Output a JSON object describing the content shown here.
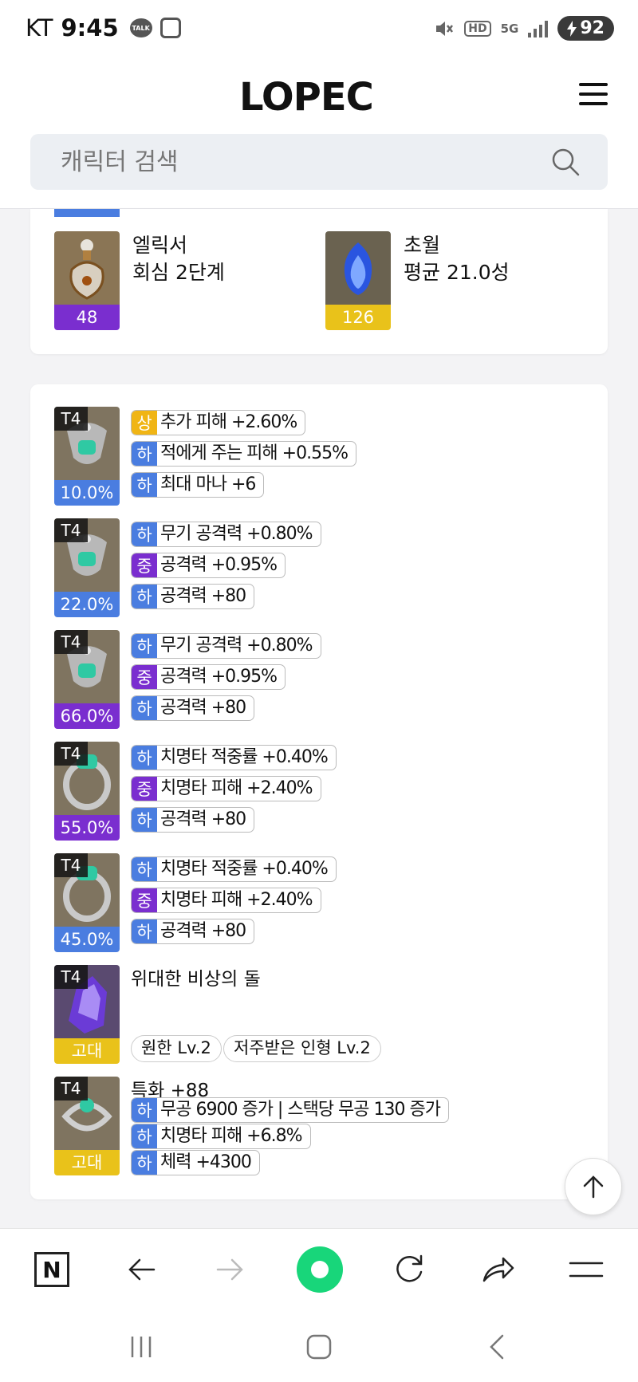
{
  "status": {
    "carrier": "KT",
    "time": "9:45",
    "talk": "TALK",
    "hd": "HD",
    "network": "5G",
    "battery": "92"
  },
  "header": {
    "logo": "LOPEC",
    "search_placeholder": "캐릭터 검색"
  },
  "card1": {
    "items": [
      {
        "name": "엘릭서",
        "detail": "회심 2단계",
        "foot": "48",
        "foot_color": "#7a2ecf"
      },
      {
        "name": "초월",
        "detail": "평균 21.0성",
        "foot": "126",
        "foot_color": "#e9c21a"
      }
    ]
  },
  "grade_colors": {
    "상": "#f0b515",
    "중": "#7a2ecf",
    "하": "#4a7de0"
  },
  "accessories": [
    {
      "tier": "T4",
      "quality": "10.0%",
      "foot_color": "#4a7de0",
      "options": [
        {
          "grade": "상",
          "text": "추가 피해 +2.60%"
        },
        {
          "grade": "하",
          "text": "적에게 주는 피해 +0.55%"
        },
        {
          "grade": "하",
          "text": "최대 마나 +6"
        }
      ]
    },
    {
      "tier": "T4",
      "quality": "22.0%",
      "foot_color": "#4a7de0",
      "options": [
        {
          "grade": "하",
          "text": "무기 공격력 +0.80%"
        },
        {
          "grade": "중",
          "text": "공격력 +0.95%"
        },
        {
          "grade": "하",
          "text": "공격력 +80"
        }
      ]
    },
    {
      "tier": "T4",
      "quality": "66.0%",
      "foot_color": "#7a2ecf",
      "options": [
        {
          "grade": "하",
          "text": "무기 공격력 +0.80%"
        },
        {
          "grade": "중",
          "text": "공격력 +0.95%"
        },
        {
          "grade": "하",
          "text": "공격력 +80"
        }
      ]
    },
    {
      "tier": "T4",
      "quality": "55.0%",
      "foot_color": "#7a2ecf",
      "options": [
        {
          "grade": "하",
          "text": "치명타 적중률 +0.40%"
        },
        {
          "grade": "중",
          "text": "치명타 피해 +2.40%"
        },
        {
          "grade": "하",
          "text": "공격력 +80"
        }
      ]
    },
    {
      "tier": "T4",
      "quality": "45.0%",
      "foot_color": "#4a7de0",
      "options": [
        {
          "grade": "하",
          "text": "치명타 적중률 +0.40%"
        },
        {
          "grade": "중",
          "text": "치명타 피해 +2.40%"
        },
        {
          "grade": "하",
          "text": "공격력 +80"
        }
      ]
    }
  ],
  "stone": {
    "tier": "T4",
    "foot": "고대",
    "foot_color": "#e9c21a",
    "name": "위대한 비상의 돌",
    "engravings": [
      "원한 Lv.2",
      "저주받은 인형 Lv.2"
    ]
  },
  "bracelet": {
    "tier": "T4",
    "foot": "고대",
    "foot_color": "#e9c21a",
    "stat": "특화 +88",
    "options": [
      {
        "grade": "하",
        "text": "무공 6900 증가 | 스택당 무공 130 증가"
      },
      {
        "grade": "하",
        "text": "치명타 피해 +6.8%"
      },
      {
        "grade": "하",
        "text": "체력 +4300"
      }
    ]
  },
  "browser": {
    "n_label": "N"
  }
}
